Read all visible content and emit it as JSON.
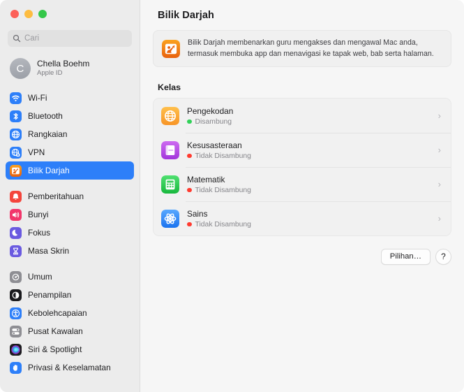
{
  "window": {
    "traffic_lights": [
      {
        "name": "close",
        "color": "#fc6058"
      },
      {
        "name": "minimize",
        "color": "#fdbc40"
      },
      {
        "name": "maximize",
        "color": "#34c749"
      }
    ]
  },
  "sidebar": {
    "search": {
      "placeholder": "Cari",
      "value": "",
      "icon": "search-icon"
    },
    "account": {
      "initial": "C",
      "name": "Chella Boehm",
      "subtitle": "Apple ID"
    },
    "groups": [
      {
        "items": [
          {
            "label": "Wi-Fi",
            "icon": "wifi-icon",
            "selected": false
          },
          {
            "label": "Bluetooth",
            "icon": "bluetooth-icon",
            "selected": false
          },
          {
            "label": "Rangkaian",
            "icon": "network-icon",
            "selected": false
          },
          {
            "label": "VPN",
            "icon": "vpn-icon",
            "selected": false
          },
          {
            "label": "Bilik Darjah",
            "icon": "classroom-icon",
            "selected": true
          }
        ]
      },
      {
        "items": [
          {
            "label": "Pemberitahuan",
            "icon": "bell-icon",
            "selected": false
          },
          {
            "label": "Bunyi",
            "icon": "speaker-icon",
            "selected": false
          },
          {
            "label": "Fokus",
            "icon": "moon-icon",
            "selected": false
          },
          {
            "label": "Masa Skrin",
            "icon": "hourglass-icon",
            "selected": false
          }
        ]
      },
      {
        "items": [
          {
            "label": "Umum",
            "icon": "gear-icon",
            "selected": false
          },
          {
            "label": "Penampilan",
            "icon": "appearance-icon",
            "selected": false
          },
          {
            "label": "Kebolehcapaian",
            "icon": "accessibility-icon",
            "selected": false
          },
          {
            "label": "Pusat Kawalan",
            "icon": "control-center-icon",
            "selected": false
          },
          {
            "label": "Siri & Spotlight",
            "icon": "siri-icon",
            "selected": false
          },
          {
            "label": "Privasi & Keselamatan",
            "icon": "privacy-hand-icon",
            "selected": false
          }
        ]
      }
    ]
  },
  "main": {
    "title": "Bilik Darjah",
    "banner": {
      "icon": "classroom-icon",
      "text": "Bilik Darjah membenarkan guru mengakses dan mengawal Mac anda, termasuk membuka app dan menavigasi ke tapak web, bab serta halaman."
    },
    "section_title": "Kelas",
    "classes": [
      {
        "name": "Pengekodan",
        "status": "Disambung",
        "status_color": "#30d158",
        "icon": "globe-icon"
      },
      {
        "name": "Kesusasteraan",
        "status": "Tidak Disambung",
        "status_color": "#ff3b30",
        "icon": "book-icon"
      },
      {
        "name": "Matematik",
        "status": "Tidak Disambung",
        "status_color": "#ff3b30",
        "icon": "calculator-icon"
      },
      {
        "name": "Sains",
        "status": "Tidak Disambung",
        "status_color": "#ff3b30",
        "icon": "atom-icon"
      }
    ],
    "chevron_glyph": "›",
    "footer": {
      "options_label": "Pilihan…",
      "help_label": "?"
    }
  }
}
